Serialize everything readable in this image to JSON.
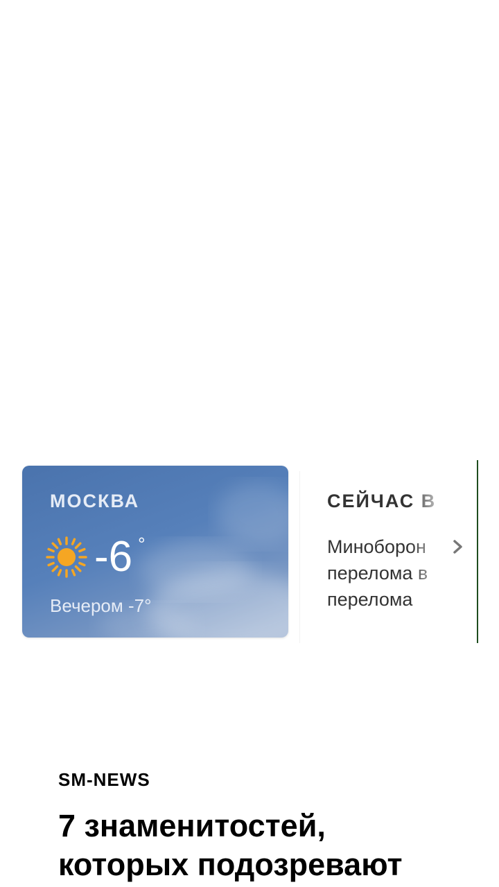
{
  "weather": {
    "city": "МОСКВА",
    "temperature": "-6",
    "degree_symbol": "°",
    "evening": "Вечером -7°",
    "icon": "sun-icon"
  },
  "news_widget": {
    "title": "СЕЙЧАС В",
    "lines": [
      "Миноборон",
      "перелома в",
      "перелома"
    ],
    "icon": "chevron-right-icon"
  },
  "article": {
    "source": "SM-NEWS",
    "title_lines": [
      "7 знаменитостей,",
      "которых подозревают"
    ]
  },
  "colors": {
    "weather_card": "#5680ba",
    "accent_line": "#1e4d1e",
    "sun": "#f5a623"
  }
}
